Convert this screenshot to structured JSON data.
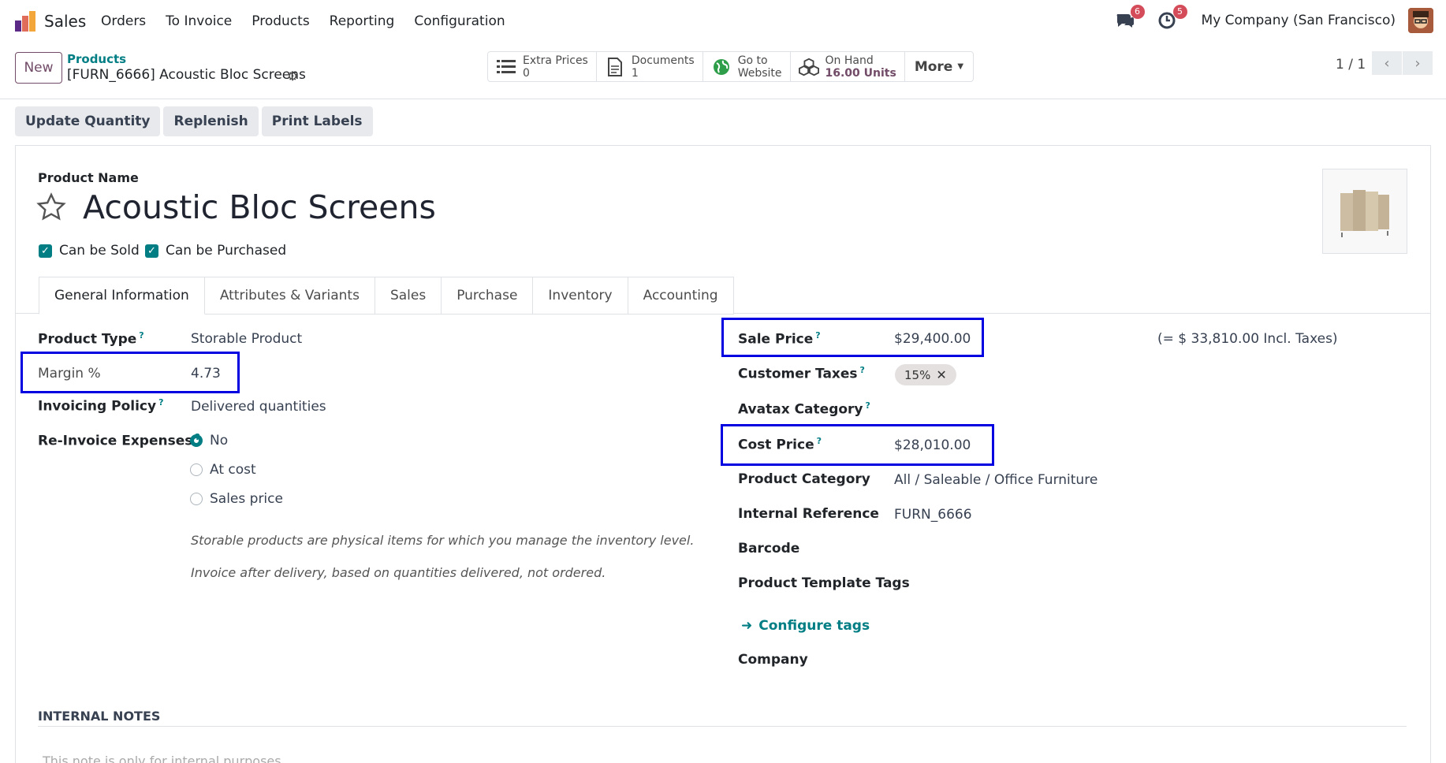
{
  "navbar": {
    "app_name": "Sales",
    "menu": [
      "Orders",
      "To Invoice",
      "Products",
      "Reporting",
      "Configuration"
    ],
    "messages_badge": "6",
    "activities_badge": "5",
    "company": "My Company (San Francisco)"
  },
  "control_panel": {
    "new_label": "New",
    "breadcrumb_parent": "Products",
    "breadcrumb_current": "[FURN_6666] Acoustic Bloc Screens",
    "smart_buttons": [
      {
        "label": "Extra Prices",
        "value": "0",
        "icon": "list-icon"
      },
      {
        "label": "Documents",
        "value": "1",
        "icon": "document-icon"
      },
      {
        "label": "Go to",
        "value": "Website",
        "icon": "globe-icon"
      },
      {
        "label": "On Hand",
        "value": "16.00 Units",
        "icon": "cubes-icon"
      }
    ],
    "more_label": "More",
    "pager": "1 / 1"
  },
  "actions": [
    "Update Quantity",
    "Replenish",
    "Print Labels"
  ],
  "product": {
    "name_label": "Product Name",
    "name": "Acoustic Bloc Screens",
    "can_be_sold": "Can be Sold",
    "can_be_purchased": "Can be Purchased"
  },
  "tabs": [
    "General Information",
    "Attributes & Variants",
    "Sales",
    "Purchase",
    "Inventory",
    "Accounting"
  ],
  "left": {
    "product_type_label": "Product Type",
    "product_type": "Storable Product",
    "margin_label": "Margin %",
    "margin": "4.73",
    "invoicing_label": "Invoicing Policy",
    "invoicing": "Delivered quantities",
    "reinvoice_label": "Re-Invoice Expenses",
    "reinvoice_options": [
      "No",
      "At cost",
      "Sales price"
    ],
    "help1": "Storable products are physical items for which you manage the inventory level.",
    "help2": "Invoice after delivery, based on quantities delivered, not ordered."
  },
  "right": {
    "sale_price_label": "Sale Price",
    "sale_price": "$29,400.00",
    "incl_taxes": "(= $ 33,810.00 Incl. Taxes)",
    "customer_taxes_label": "Customer Taxes",
    "tax_tag": "15%",
    "avatax_label": "Avatax Category",
    "cost_price_label": "Cost Price",
    "cost_price": "$28,010.00",
    "category_label": "Product Category",
    "category": "All / Saleable / Office Furniture",
    "internal_ref_label": "Internal Reference",
    "internal_ref": "FURN_6666",
    "barcode_label": "Barcode",
    "tags_label": "Product Template Tags",
    "configure_tags": "Configure tags",
    "company_label": "Company"
  },
  "notes": {
    "label": "INTERNAL NOTES",
    "placeholder": "This note is only for internal purposes."
  },
  "colors": {
    "brand": "#714b67",
    "accent": "#017e84",
    "highlight": "#0000e0"
  }
}
